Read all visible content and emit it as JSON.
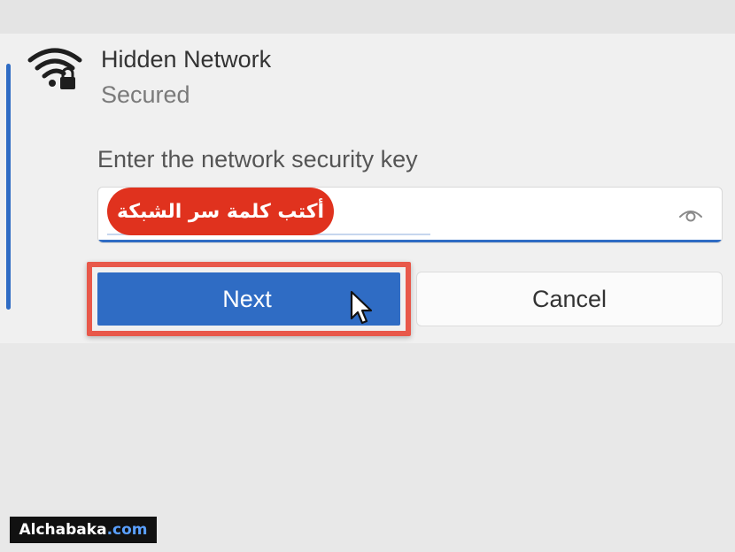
{
  "network": {
    "name": "Hidden Network",
    "status": "Secured"
  },
  "security_key": {
    "label": "Enter the network security key",
    "value": ""
  },
  "annotation": {
    "text": "أكتب كلمة سر الشبكة"
  },
  "buttons": {
    "next_label": "Next",
    "cancel_label": "Cancel"
  },
  "watermark": {
    "main": "Alchabaka",
    "tld": ".com"
  },
  "colors": {
    "accent": "#2f6cc4",
    "annotation_red": "#e0321e",
    "highlight_red": "#e8584a"
  },
  "icons": {
    "network": "wifi-secured-icon",
    "reveal": "eye-icon",
    "pointer": "mouse-cursor-icon"
  }
}
